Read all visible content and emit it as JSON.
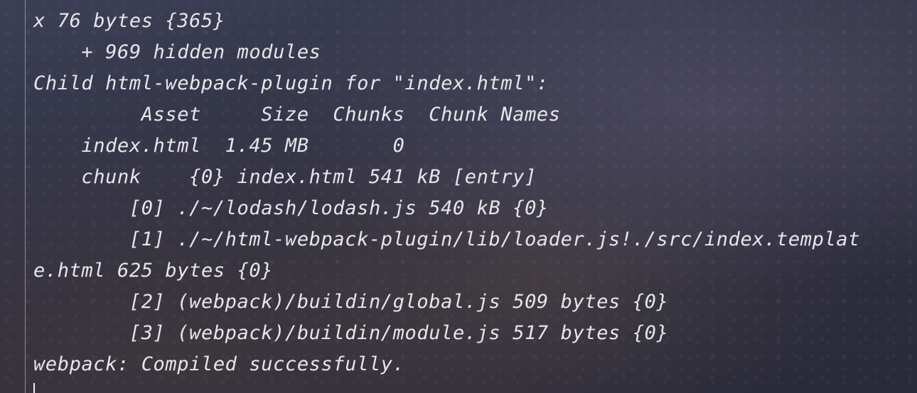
{
  "terminal": {
    "lines": [
      "x 76 bytes {365}",
      "    + 969 hidden modules",
      "Child html-webpack-plugin for \"index.html\":",
      "         Asset     Size  Chunks  Chunk Names",
      "    index.html  1.45 MB       0",
      "    chunk    {0} index.html 541 kB [entry]",
      "        [0] ./~/lodash/lodash.js 540 kB {0}",
      "        [1] ./~/html-webpack-plugin/lib/loader.js!./src/index.templat",
      "e.html 625 bytes {0}",
      "        [2] (webpack)/buildin/global.js 509 bytes {0}",
      "        [3] (webpack)/buildin/module.js 517 bytes {0}",
      "webpack: Compiled successfully."
    ]
  }
}
